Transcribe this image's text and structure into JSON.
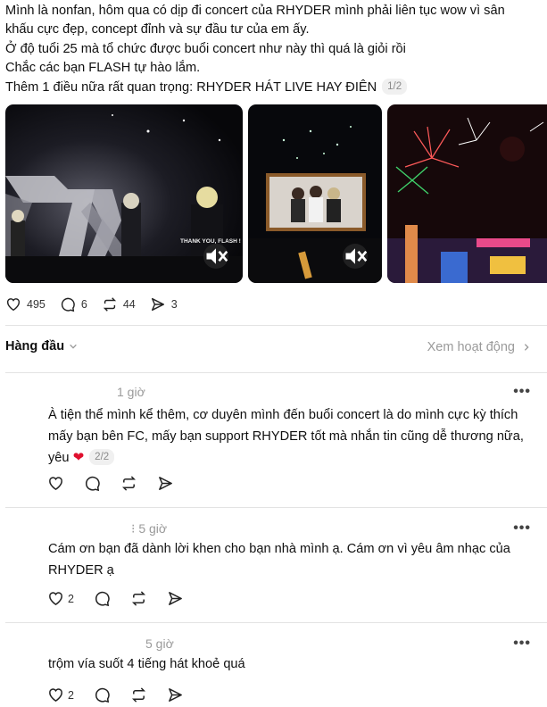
{
  "post": {
    "lines": [
      "Mình là nonfan, hôm qua có dịp đi concert của RHYDER mình phải liên tục wow vì sân",
      "khấu cực đẹp, concept đỉnh và sự đầu tư của em ấy.",
      "Ở độ tuổi 25 mà tổ chức được buổi concert như này thì quá là giỏi rồi",
      "Chắc các bạn FLASH tự hào lắm.",
      "Thêm 1 điều nữa rất quan trọng: RHYDER HÁT LIVE HAY ĐIÊN"
    ],
    "pager": "1/2",
    "media_caption": "THANK YOU, FLASH !"
  },
  "stats": {
    "likes": "495",
    "comments": "6",
    "reposts": "44",
    "shares": "3"
  },
  "sort": {
    "label": "Hàng đầu",
    "activity_label": "Xem hoạt động"
  },
  "comments": [
    {
      "time": "1 giờ",
      "lines": [
        "À tiện thể mình kể thêm, cơ duyên mình đến buổi concert là do mình cực kỳ thích",
        "mấy bạn bên FC, mấy bạn support RHYDER tốt mà nhắn tin cũng dễ thương nữa,",
        "yêu"
      ],
      "heart": "❤",
      "pager": "2/2",
      "likes": "",
      "replies": ""
    },
    {
      "time": "5 giờ",
      "prefix": "⁝",
      "lines": [
        "Cám ơn bạn đã dành lời khen cho bạn nhà mình ạ. Cám ơn vì yêu âm nhạc của",
        "RHYDER ạ"
      ],
      "likes": "2"
    },
    {
      "time": "5 giờ",
      "lines": [
        "trộm vía suốt 4 tiếng hát khoẻ quá"
      ],
      "likes": "2"
    }
  ],
  "colors": {
    "text": "#101010",
    "muted": "#9a9a9a",
    "heart": "#e0102e",
    "divider": "#e3e3e3"
  }
}
